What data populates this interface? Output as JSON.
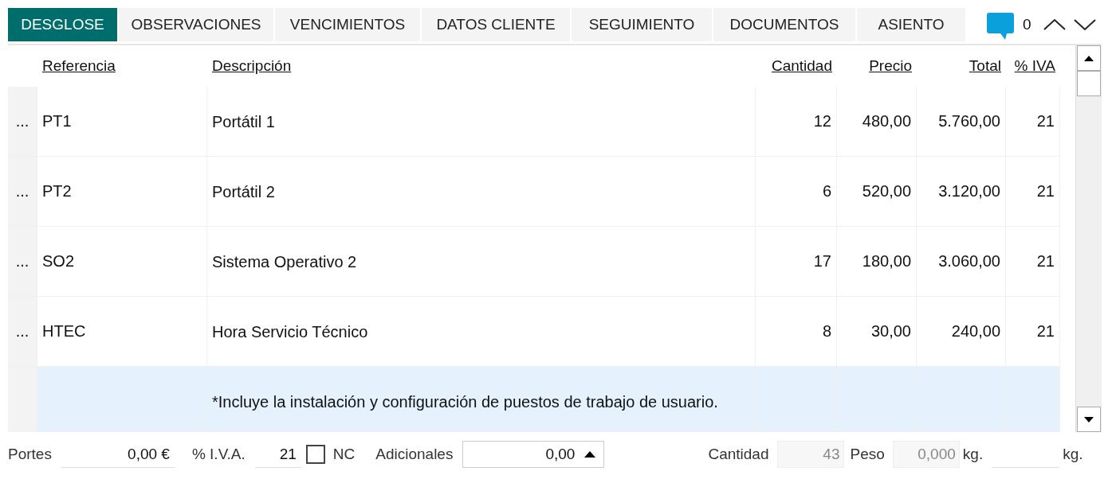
{
  "tabs": [
    {
      "label": "DESGLOSE",
      "selected": true
    },
    {
      "label": "OBSERVACIONES",
      "selected": false
    },
    {
      "label": "VENCIMIENTOS",
      "selected": false
    },
    {
      "label": "DATOS CLIENTE",
      "selected": false
    },
    {
      "label": "SEGUIMIENTO",
      "selected": false
    },
    {
      "label": "DOCUMENTOS",
      "selected": false
    },
    {
      "label": "ASIENTO",
      "selected": false
    }
  ],
  "comments": {
    "count": "0"
  },
  "table": {
    "columns": [
      "Referencia",
      "Descripción",
      "Cantidad",
      "Precio",
      "Total",
      "% IVA"
    ],
    "rows": [
      {
        "handle": "...",
        "cells": [
          "PT1",
          "Portátil 1",
          "12",
          "480,00",
          "5.760,00",
          "21"
        ],
        "selected": false
      },
      {
        "handle": "...",
        "cells": [
          "PT2",
          "Portátil 2",
          "6",
          "520,00",
          "3.120,00",
          "21"
        ],
        "selected": false
      },
      {
        "handle": "...",
        "cells": [
          "SO2",
          "Sistema Operativo 2",
          "17",
          "180,00",
          "3.060,00",
          "21"
        ],
        "selected": false
      },
      {
        "handle": "...",
        "cells": [
          "HTEC",
          "Hora Servicio Técnico",
          "8",
          "30,00",
          "240,00",
          "21"
        ],
        "selected": false
      },
      {
        "cells": [
          "",
          "*Incluye la instalación y configuración de puestos de trabajo de usuario.",
          "",
          "",
          "",
          ""
        ],
        "selected": true
      }
    ]
  },
  "footer": {
    "portes": {
      "label": "Portes",
      "value": "0,00 €"
    },
    "iva": {
      "label": "% I.V.A.",
      "value": "21"
    },
    "nc": {
      "label": "NC",
      "checked": false
    },
    "adicionales": {
      "label": "Adicionales",
      "value": "0,00"
    },
    "cantidad": {
      "label": "Cantidad",
      "value": "43",
      "disabled": true
    },
    "peso": {
      "label": "Peso",
      "value": "0,000",
      "unit": "kg.",
      "disabled": true
    },
    "extra": {
      "unit": "kg."
    }
  }
}
